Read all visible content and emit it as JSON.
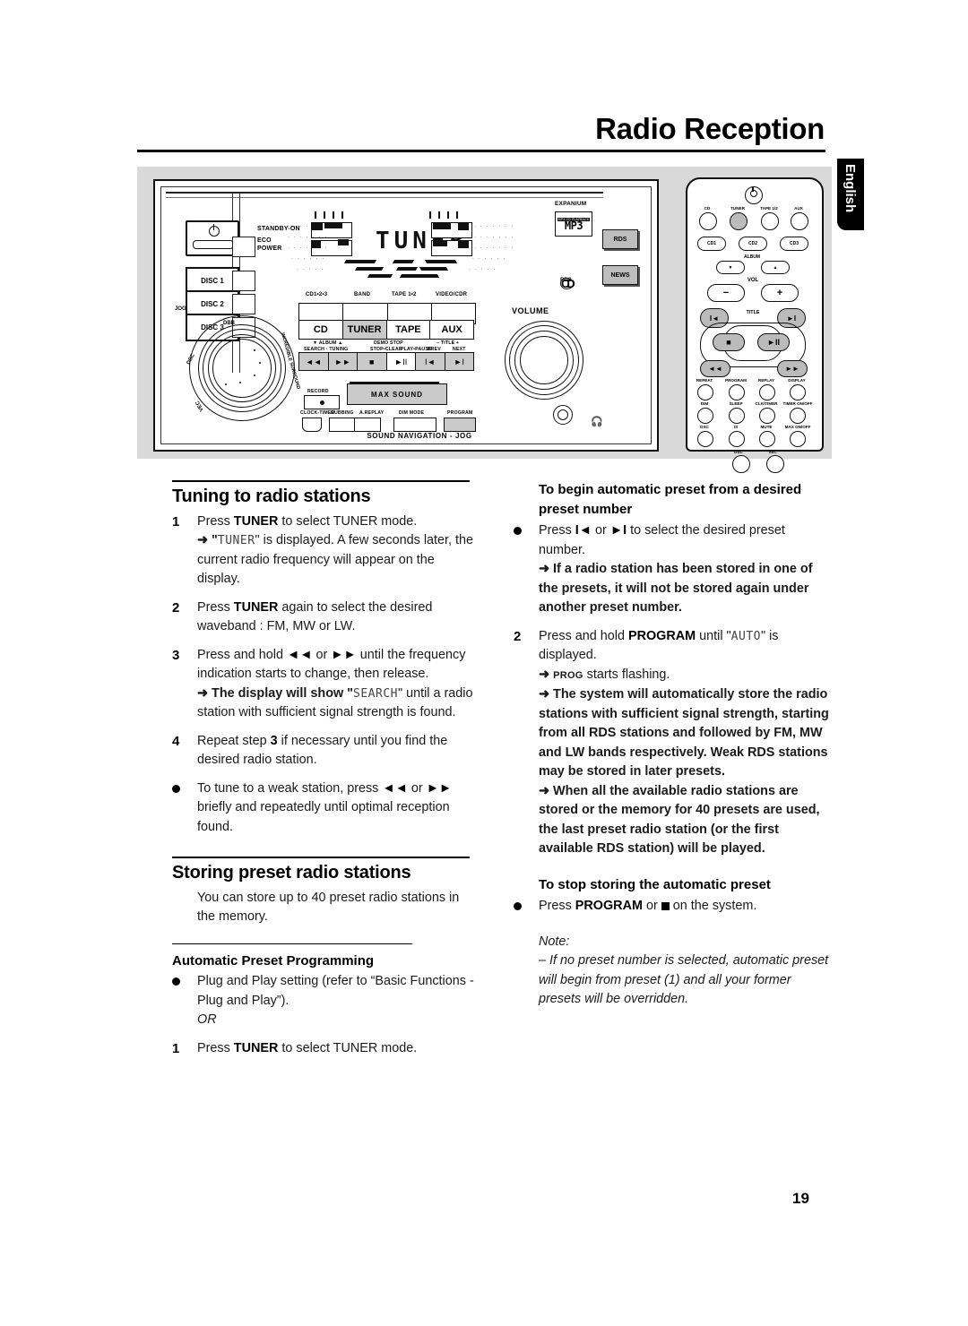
{
  "header": {
    "title": "Radio Reception",
    "language_tab": "English"
  },
  "page_number": "19",
  "illustration": {
    "unit": {
      "power_labels": {
        "standby": "STANDBY-ON",
        "eco": "ECO",
        "power": "POWER"
      },
      "disc_buttons": [
        "DISC 1",
        "DISC 2",
        "DISC 3"
      ],
      "display_text": "TUNER",
      "logos": {
        "expanium": "EXPANIUM",
        "mp3": "MP3",
        "mp3_sub": "MP3 CD PLAYBACK",
        "cd_rds_top": "CD",
        "cd_rds_bottom": "RDS"
      },
      "source_top_labels": [
        "CD1•2•3",
        "BAND",
        "TAPE 1•2",
        "VIDEO/CDR"
      ],
      "source_buttons": [
        "CD",
        "TUNER",
        "TAPE",
        "AUX"
      ],
      "transport_upper_labels": [
        "▼ ALBUM ▲",
        "SEARCH · TUNING",
        "DEMO STOP",
        "STOP•CLEAR",
        "PLAY•PAUSE",
        "PREV",
        "− TITLE +",
        "NEXT"
      ],
      "transport_buttons": [
        "◄◄",
        "►►",
        "■",
        "►II",
        "I◄",
        "►I"
      ],
      "max_sound": "MAX SOUND",
      "record_label": "RECORD",
      "bottom_labels": [
        "CLOCK-TIMER",
        "DUBBING",
        "A.REPLAY",
        "DIM MODE",
        "PROGRAM"
      ],
      "sound_navigation": "SOUND NAVIGATION - JOG",
      "jog_labels": [
        "JOG",
        "DBB",
        "DSC",
        "VEC",
        "INCREDIBLE SURROUND"
      ],
      "volume_label": "VOLUME",
      "side_buttons": [
        "RDS",
        "NEWS"
      ],
      "headphone_icon": "headphone"
    },
    "remote": {
      "power_icon": "power",
      "source_row": [
        "CD",
        "TUNER",
        "TAPE 1/2",
        "AUX"
      ],
      "disc_row": [
        "CD1",
        "CD2",
        "CD3"
      ],
      "album_label": "ALBUM",
      "album_buttons": [
        "▼",
        "▲"
      ],
      "vol_label": "VOL",
      "vol_buttons": [
        "−",
        "+"
      ],
      "title_label": "TITLE",
      "title_buttons": [
        "I◄",
        "►I"
      ],
      "center_buttons": [
        "■",
        "►II"
      ],
      "seek_buttons": [
        "◄◄",
        "►►"
      ],
      "grid_labels": [
        [
          "REPEAT",
          "PROGRAM",
          "REPLAY",
          "DISPLAY"
        ],
        [
          "DIM",
          "SLEEP",
          "CLK/TIMER",
          "TIMER ON/OFF"
        ],
        [
          "DSC",
          "IS",
          "MUTE",
          "MAX ON/OFF"
        ]
      ],
      "bottom_labels": [
        "DSC",
        "VEC"
      ]
    }
  },
  "left_column": {
    "section1": {
      "heading": "Tuning to radio stations",
      "steps": [
        {
          "marker": "1",
          "lines": [
            {
              "parts": [
                {
                  "t": "Press ",
                  "s": "n"
                },
                {
                  "t": "TUNER",
                  "s": "b"
                },
                {
                  "t": " to select TUNER mode.",
                  "s": "n"
                }
              ]
            },
            {
              "parts": [
                {
                  "t": "➜ \"",
                  "s": "a"
                },
                {
                  "t": "TUNER",
                  "s": "seg"
                },
                {
                  "t": "\" is displayed.  A few seconds later, the current radio frequency will appear on the display.",
                  "s": "n"
                }
              ]
            }
          ]
        },
        {
          "marker": "2",
          "lines": [
            {
              "parts": [
                {
                  "t": "Press ",
                  "s": "n"
                },
                {
                  "t": "TUNER",
                  "s": "b"
                },
                {
                  "t": " again to select the desired waveband : FM, MW or LW.",
                  "s": "n"
                }
              ]
            }
          ]
        },
        {
          "marker": "3",
          "lines": [
            {
              "parts": [
                {
                  "t": "Press and hold ",
                  "s": "n"
                },
                {
                  "t": "◄◄",
                  "s": "b"
                },
                {
                  "t": " or ",
                  "s": "n"
                },
                {
                  "t": "►►",
                  "s": "b"
                },
                {
                  "t": " until the frequency indication starts to change, then release.",
                  "s": "n"
                }
              ]
            },
            {
              "parts": [
                {
                  "t": "➜ The display will show \"",
                  "s": "a"
                },
                {
                  "t": "SEARCH",
                  "s": "seg"
                },
                {
                  "t": "\" until a radio station with sufficient signal strength is found.",
                  "s": "n"
                }
              ]
            }
          ]
        },
        {
          "marker": "4",
          "lines": [
            {
              "parts": [
                {
                  "t": "Repeat step ",
                  "s": "n"
                },
                {
                  "t": "3",
                  "s": "b"
                },
                {
                  "t": " if necessary until you find the desired radio station.",
                  "s": "n"
                }
              ]
            }
          ]
        },
        {
          "marker": "●",
          "lines": [
            {
              "parts": [
                {
                  "t": "To tune to a weak station, press ",
                  "s": "n"
                },
                {
                  "t": "◄◄",
                  "s": "b"
                },
                {
                  "t": " or ",
                  "s": "n"
                },
                {
                  "t": "►►",
                  "s": "b"
                },
                {
                  "t": " briefly and repeatedly until optimal reception found.",
                  "s": "n"
                }
              ]
            }
          ]
        }
      ]
    },
    "section2": {
      "heading": "Storing preset radio stations",
      "intro": "You can store up to 40 preset radio stations in the memory.",
      "subheading": "Automatic Preset Programming",
      "steps": [
        {
          "marker": "●",
          "lines": [
            {
              "parts": [
                {
                  "t": "Plug and Play setting (refer to “Basic Functions - Plug and Play”).",
                  "s": "n"
                }
              ]
            },
            {
              "parts": [
                {
                  "t": "OR",
                  "s": "it"
                }
              ]
            }
          ]
        },
        {
          "marker": "1",
          "lines": [
            {
              "parts": [
                {
                  "t": "Press ",
                  "s": "n"
                },
                {
                  "t": "TUNER",
                  "s": "b"
                },
                {
                  "t": " to select TUNER mode.",
                  "s": "n"
                }
              ]
            }
          ]
        }
      ]
    }
  },
  "right_column": {
    "section1": {
      "heading": "To begin automatic preset from a desired preset number",
      "steps": [
        {
          "marker": "●",
          "lines": [
            {
              "parts": [
                {
                  "t": "Press ",
                  "s": "n"
                },
                {
                  "t": "I◄",
                  "s": "b"
                },
                {
                  "t": " or ",
                  "s": "n"
                },
                {
                  "t": "►I",
                  "s": "b"
                },
                {
                  "t": " to select the desired preset number.",
                  "s": "n"
                }
              ]
            },
            {
              "parts": [
                {
                  "t": "➜ If a radio station has been stored in one of the presets, it will not be stored again under another preset number.",
                  "s": "a"
                }
              ]
            }
          ]
        },
        {
          "marker": "2",
          "lines": [
            {
              "parts": [
                {
                  "t": "Press and hold ",
                  "s": "n"
                },
                {
                  "t": "PROGRAM",
                  "s": "b"
                },
                {
                  "t": " until \"",
                  "s": "n"
                },
                {
                  "t": "AUTO",
                  "s": "seg"
                },
                {
                  "t": "\" is displayed.",
                  "s": "n"
                }
              ]
            },
            {
              "parts": [
                {
                  "t": "➜ ",
                  "s": "a"
                },
                {
                  "t": "PROG",
                  "s": "sc"
                },
                {
                  "t": " starts flashing.",
                  "s": "n"
                }
              ]
            },
            {
              "parts": [
                {
                  "t": "➜ The system will automatically store the radio stations with sufficient signal strength, starting from all RDS stations and followed by FM, MW and LW bands respectively.  Weak RDS stations may be stored in later presets.",
                  "s": "a"
                }
              ]
            },
            {
              "parts": [
                {
                  "t": "➜ When all the available radio stations are stored or the memory for 40 presets are used, the last preset radio station (or the first available RDS station) will be played.",
                  "s": "a"
                }
              ]
            }
          ]
        }
      ]
    },
    "section2": {
      "heading": "To stop storing the automatic preset",
      "steps": [
        {
          "marker": "●",
          "lines": [
            {
              "parts": [
                {
                  "t": "Press ",
                  "s": "n"
                },
                {
                  "t": "PROGRAM",
                  "s": "b"
                },
                {
                  "t": " or ",
                  "s": "n"
                },
                {
                  "t": "■",
                  "s": "sq"
                },
                {
                  "t": " on the system.",
                  "s": "n"
                }
              ]
            }
          ]
        }
      ]
    },
    "note": {
      "label": "Note:",
      "text": "– If no preset number is selected, automatic preset will begin from preset (1) and all your former presets will be overridden."
    }
  }
}
